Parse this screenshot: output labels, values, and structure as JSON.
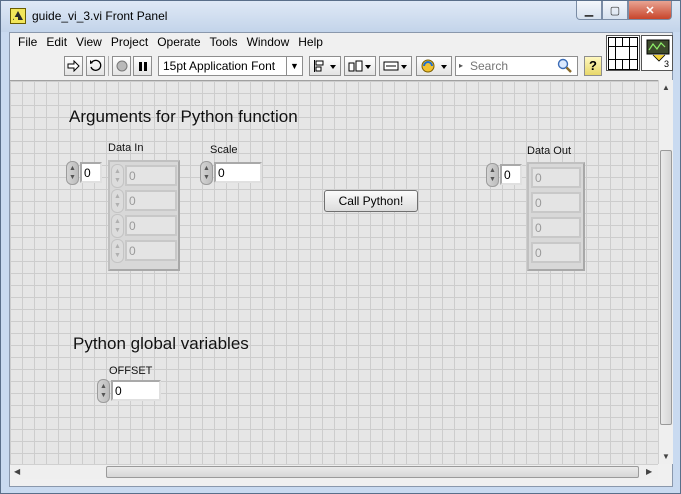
{
  "window": {
    "title": "guide_vi_3.vi Front Panel",
    "min_glyph": "▁",
    "max_glyph": "▢",
    "close_glyph": "✕"
  },
  "menu": [
    "File",
    "Edit",
    "View",
    "Project",
    "Operate",
    "Tools",
    "Window",
    "Help"
  ],
  "toolbar": {
    "font_selector": "15pt Application Font",
    "search_placeholder": "Search",
    "help_label": "?"
  },
  "vi_icon": {
    "connector_count": "3"
  },
  "panel": {
    "arguments_title": "Arguments for Python function",
    "globals_title": "Python global variables",
    "data_in": {
      "label": "Data In",
      "index": "0",
      "elements": [
        "0",
        "0",
        "0",
        "0"
      ]
    },
    "scale": {
      "label": "Scale",
      "value": "0"
    },
    "call_button": "Call Python!",
    "data_out": {
      "label": "Data Out",
      "index": "0",
      "elements": [
        "0",
        "0",
        "0",
        "0"
      ]
    },
    "offset": {
      "label": "OFFSET",
      "value": "0"
    }
  },
  "colors": {
    "canvas": "#e6e6e6",
    "grid": "#cdcdcd",
    "titlebar": "#c9daf0",
    "close_button": "#c8452b"
  }
}
